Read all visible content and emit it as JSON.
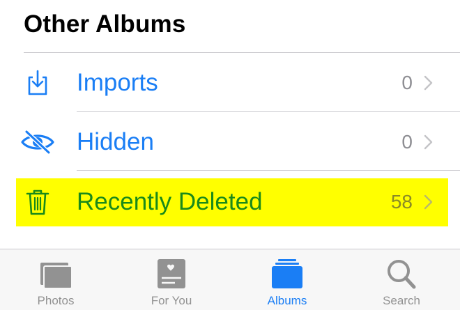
{
  "section": {
    "title": "Other Albums"
  },
  "albums": [
    {
      "label": "Imports",
      "count": "0",
      "icon": "import-tray-icon"
    },
    {
      "label": "Hidden",
      "count": "0",
      "icon": "eye-slash-icon"
    },
    {
      "label": "Recently Deleted",
      "count": "58",
      "icon": "trash-icon",
      "highlighted": true
    }
  ],
  "tabbar": {
    "tabs": [
      {
        "label": "Photos",
        "icon": "photos-icon",
        "active": false
      },
      {
        "label": "For You",
        "icon": "for-you-icon",
        "active": false
      },
      {
        "label": "Albums",
        "icon": "albums-icon",
        "active": true
      },
      {
        "label": "Search",
        "icon": "search-icon",
        "active": false
      }
    ]
  },
  "colors": {
    "accent": "#1a7ef5",
    "highlight": "#ffff00",
    "highlighted_text": "#1a8a1a",
    "inactive_tab": "#929292",
    "count_text": "#8e8e93"
  }
}
